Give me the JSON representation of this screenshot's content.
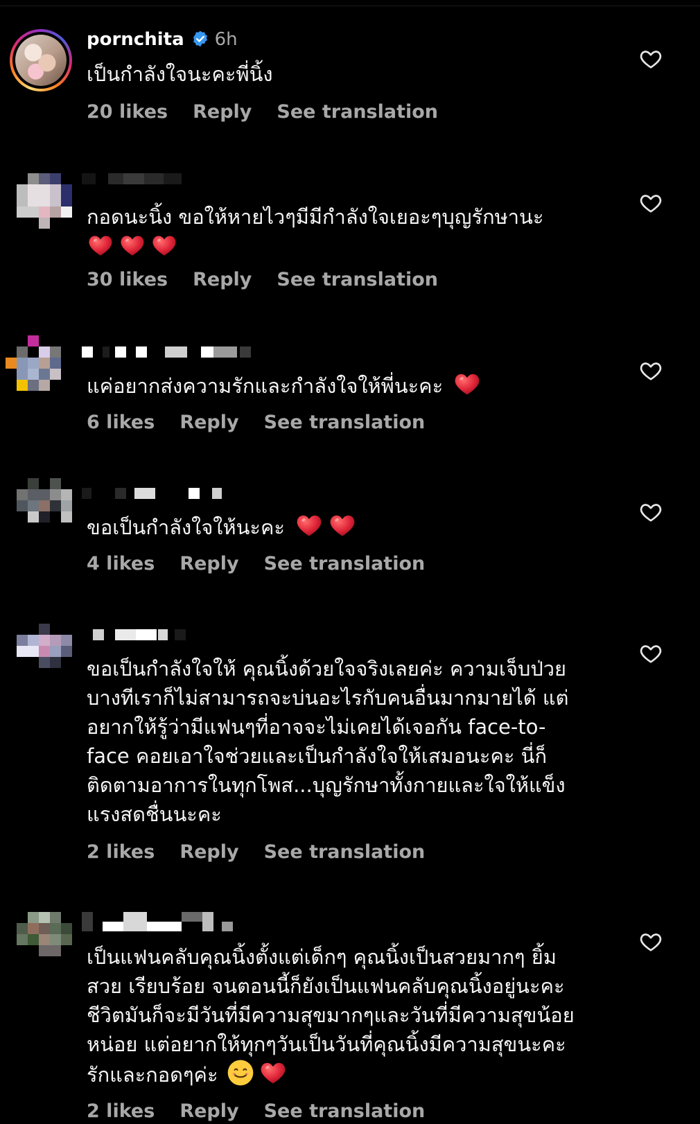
{
  "comments": [
    {
      "username": "pornchita",
      "time": "6h",
      "text": "เป็นกำลังใจนะคะพี่นิ้ง",
      "likes": "20 likes",
      "reply": "Reply",
      "translate": "See translation"
    },
    {
      "text": "กอดนะนิ้ง ขอให้หายไวๆมีมีกำลังใจเยอะๆบุญรักษานะ",
      "likes": "30 likes",
      "reply": "Reply",
      "translate": "See translation"
    },
    {
      "text": "แค่อยากส่งความรักและกำลังใจให้พี่นะคะ",
      "likes": "6 likes",
      "reply": "Reply",
      "translate": "See translation"
    },
    {
      "text": "ขอเป็นกำลังใจให้นะคะ",
      "likes": "4 likes",
      "reply": "Reply",
      "translate": "See translation"
    },
    {
      "lines": [
        "ขอเป็นกำลังใจให้ คุณนิ้งด้วยใจจริงเลยค่ะ ความเจ็บป่วย",
        "บางทีเราก็ไม่สามารถจะบ่นอะไรกับคนอื่นมากมายได้ แต่",
        "อยากให้รู้ว่ามีแฟนๆที่อาจจะไม่เคยได้เจอกัน face-to-",
        "face คอยเอาใจช่วยและเป็นกำลังใจให้เสมอนะคะ นี่ก็",
        "ติดตามอาการในทุกโพส...บุญรักษาทั้งกายและใจให้แข็ง",
        "แรงสดชื่นนะคะ"
      ],
      "likes": "2 likes",
      "reply": "Reply",
      "translate": "See translation"
    },
    {
      "lines": [
        "เป็นแฟนคลับคุณนิ้งตั้งแต่เด็กๆ คุณนิ้งเป็นสวยมากๆ ยิ้ม",
        "สวย เรียบร้อย จนตอนนี้ก็ยังเป็นแฟนคลับคุณนิ้งอยู่นะคะ",
        "ชีวิตมันก็จะมีวันที่มีความสุขมากๆและวันที่มีความสุขน้อย",
        "หน่อย แต่อยากให้ทุกๆวันเป็นวันที่คุณนิ้งมีความสุขนะคะ",
        "รักและกอดๆค่ะ"
      ],
      "likes": "2 likes",
      "reply": "Reply",
      "translate": "See translation"
    }
  ],
  "colors": {
    "background": "#000000",
    "text": "#f5f5f5",
    "muted": "#a8a8a8",
    "verified": "#3797f0",
    "heart": "#e0263a"
  }
}
